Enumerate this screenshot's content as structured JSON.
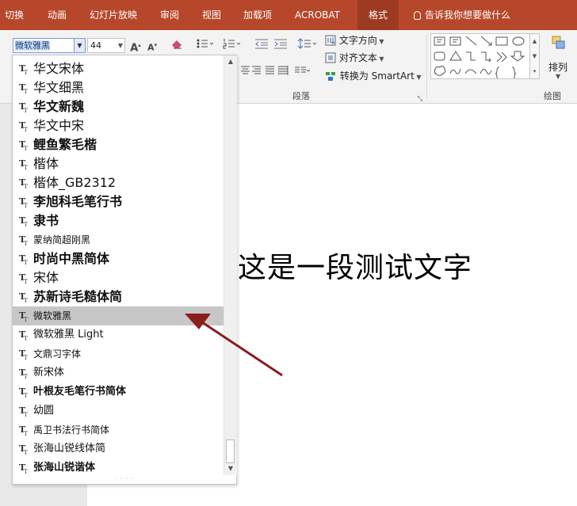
{
  "tabs": [
    {
      "label": "切换"
    },
    {
      "label": "动画"
    },
    {
      "label": "幻灯片放映"
    },
    {
      "label": "审阅"
    },
    {
      "label": "视图"
    },
    {
      "label": "加载项"
    },
    {
      "label": "ACROBAT"
    },
    {
      "label": "格式"
    }
  ],
  "tell_me": "告诉我你想要做什么",
  "font_box": {
    "value": "微软雅黑"
  },
  "size_box": {
    "value": "44"
  },
  "paragraph": {
    "text_direction": "文字方向",
    "align_text": "对齐文本",
    "convert_smartart": "转换为 SmartArt",
    "label": "段落"
  },
  "drawing": {
    "arrange": "排列",
    "label": "绘图"
  },
  "slide_text": "这是一段测试文字",
  "font_list": {
    "selected": "微软雅黑",
    "items": [
      "华文宋体",
      "华文细黑",
      "华文新魏",
      "华文中宋",
      "鲤鱼繁毛楷",
      "楷体",
      "楷体_GB2312",
      "李旭科毛笔行书",
      "隶书",
      "蒙纳简超刚黑",
      "时尚中黑简体",
      "宋体",
      "苏新诗毛糙体简",
      "微软雅黑",
      "微软雅黑 Light",
      "文鼎习字体",
      "新宋体",
      "叶根友毛笔行书简体",
      "幼圆",
      "禹卫书法行书简体",
      "张海山锐线体简",
      "张海山锐谐体"
    ]
  },
  "colors": {
    "accent": "#b7472a",
    "accent_dark": "#9c3b22",
    "arrow": "#8b1d1d",
    "selection": "#c7c7c7"
  }
}
